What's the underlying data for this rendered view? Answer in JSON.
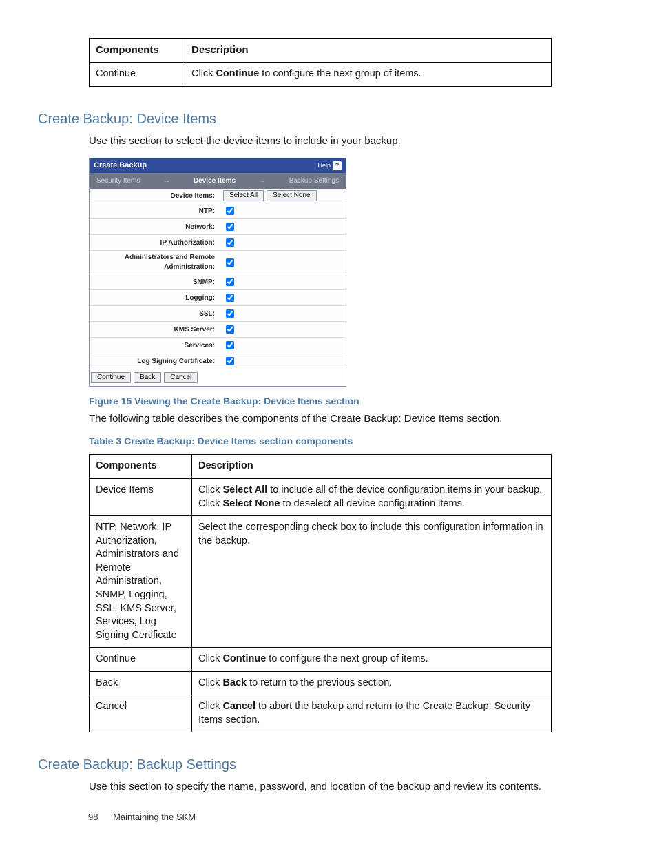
{
  "top_table": {
    "headers": [
      "Components",
      "Description"
    ],
    "row": {
      "c1": "Continue",
      "c2_pre": "Click ",
      "c2_b": "Continue",
      "c2_post": " to configure the next group of items."
    }
  },
  "section1": {
    "heading": "Create Backup: Device Items",
    "intro": "Use this section to select the device items to include in your backup."
  },
  "ui": {
    "title": "Create Backup",
    "help": "Help",
    "tabs": {
      "t1": "Security Items",
      "t2": "Device Items",
      "t3": "Backup Settings"
    },
    "header_label": "Device Items:",
    "select_all": "Select All",
    "select_none": "Select None",
    "items": [
      "NTP:",
      "Network:",
      "IP Authorization:",
      "Administrators and Remote Administration:",
      "SNMP:",
      "Logging:",
      "SSL:",
      "KMS Server:",
      "Services:",
      "Log Signing Certificate:"
    ],
    "btn_continue": "Continue",
    "btn_back": "Back",
    "btn_cancel": "Cancel"
  },
  "fig_caption": "Figure 15 Viewing the Create Backup: Device Items section",
  "table_lead": "The following table describes the components of the Create Backup: Device Items section.",
  "table_caption": "Table 3 Create Backup: Device Items section components",
  "big_table": {
    "headers": [
      "Components",
      "Description"
    ],
    "rows": {
      "r1c1": "Device Items",
      "r1_pre": "Click ",
      "r1_b1": "Select All",
      "r1_mid": " to include all of the device configuration items in your backup. Click ",
      "r1_b2": "Select None",
      "r1_post": " to deselect all device configuration items.",
      "r2c1": "NTP, Network, IP Authorization, Administrators and Remote Administration, SNMP, Logging, SSL, KMS Server, Services, Log Signing Certificate",
      "r2c2": "Select the corresponding check box to include this configuration information in the backup.",
      "r3c1": "Continue",
      "r3_pre": "Click ",
      "r3_b": "Continue",
      "r3_post": " to configure the next group of items.",
      "r4c1": "Back",
      "r4_pre": "Click ",
      "r4_b": "Back",
      "r4_post": " to return to the previous section.",
      "r5c1": "Cancel",
      "r5_pre": "Click ",
      "r5_b": "Cancel",
      "r5_post": " to abort the backup and return to the Create Backup: Security Items section."
    }
  },
  "section2": {
    "heading": "Create Backup: Backup Settings",
    "intro": "Use this section to specify the name, password, and location of the backup and review its contents."
  },
  "footer": {
    "page": "98",
    "title": "Maintaining the SKM"
  }
}
